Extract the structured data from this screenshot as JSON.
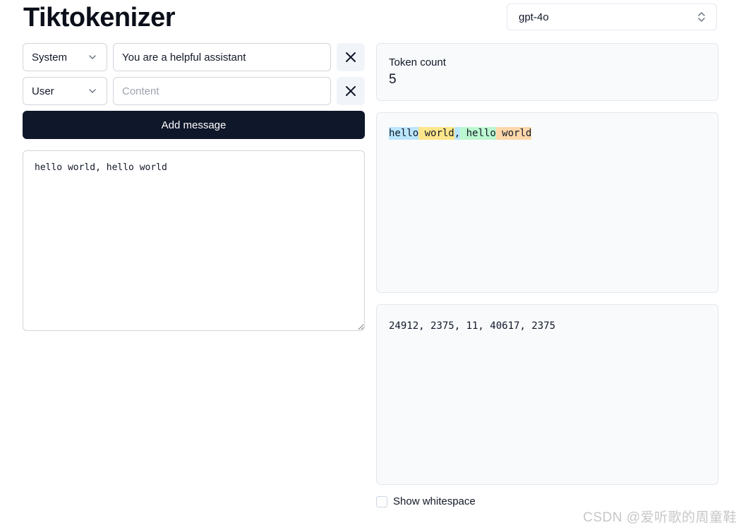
{
  "app": {
    "title": "Tiktokenizer"
  },
  "model_select": {
    "value": "gpt-4o"
  },
  "messages": [
    {
      "role": "System",
      "content": "You are a helpful assistant",
      "placeholder": "Content"
    },
    {
      "role": "User",
      "content": "",
      "placeholder": "Content"
    }
  ],
  "add_button": {
    "label": "Add message"
  },
  "prompt": {
    "text": "hello world, hello world"
  },
  "token_count": {
    "label": "Token count",
    "value": "5"
  },
  "tokens": [
    {
      "text": "hello",
      "color": "#bae6fd"
    },
    {
      "text": " world",
      "color": "#fde68a"
    },
    {
      "text": ",",
      "color": "#bae6fd"
    },
    {
      "text": " hello",
      "color": "#bbf7d0"
    },
    {
      "text": " world",
      "color": "#fed7aa"
    }
  ],
  "token_ids": {
    "text": "24912, 2375, 11, 40617, 2375"
  },
  "show_whitespace": {
    "label": "Show whitespace",
    "checked": false
  },
  "watermark": {
    "text": "CSDN @爱听歌的周童鞋"
  }
}
